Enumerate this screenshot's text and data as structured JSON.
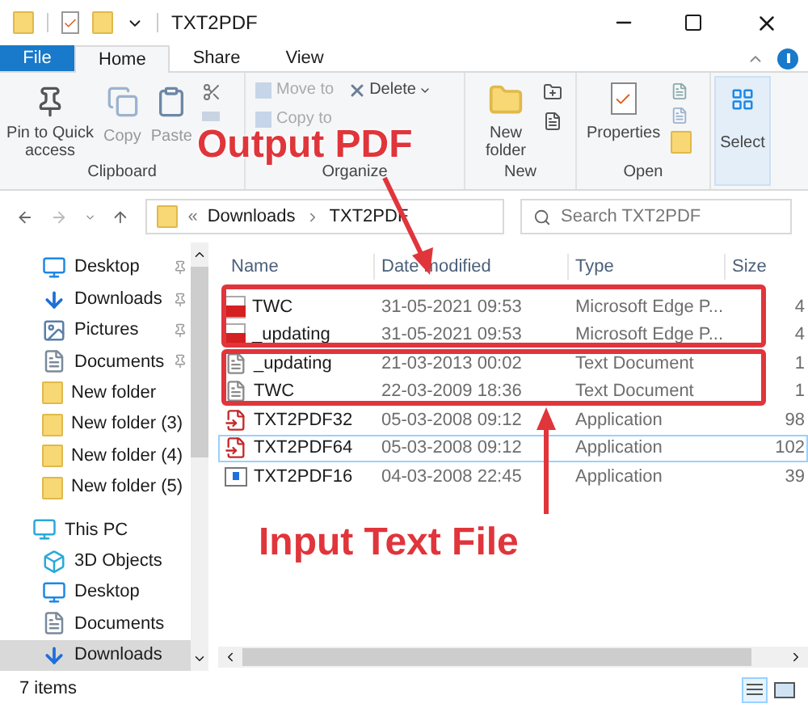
{
  "window": {
    "title": "TXT2PDF"
  },
  "tabs": [
    {
      "label": "File",
      "kind": "file",
      "selected": false
    },
    {
      "label": "Home",
      "kind": "tab",
      "selected": true
    },
    {
      "label": "Share",
      "kind": "tab",
      "selected": false
    },
    {
      "label": "View",
      "kind": "tab",
      "selected": false
    }
  ],
  "ribbon": {
    "clipboard": {
      "label": "Clipboard",
      "pin": "Pin to Quick access",
      "copy": "Copy",
      "paste": "Paste"
    },
    "organize": {
      "label": "Organize",
      "move_to": "Move to",
      "copy_to": "Copy to",
      "delete": "Delete"
    },
    "new": {
      "label": "New",
      "new_folder": "New folder"
    },
    "open": {
      "label": "Open",
      "properties": "Properties"
    },
    "select": {
      "label": "Select"
    }
  },
  "address": {
    "separator": "«",
    "path": [
      "Downloads",
      "TXT2PDF"
    ],
    "search": {
      "placeholder": "Search TXT2PDF"
    }
  },
  "sidebar": {
    "quick_access": [
      {
        "label": "Desktop",
        "kind": "desktop",
        "pinned": true,
        "selected": false
      },
      {
        "label": "Downloads",
        "kind": "downloads",
        "pinned": true,
        "selected": false
      },
      {
        "label": "Pictures",
        "kind": "pictures",
        "pinned": true,
        "selected": false
      },
      {
        "label": "Documents",
        "kind": "documents",
        "pinned": true,
        "selected": false
      },
      {
        "label": "New folder",
        "kind": "folder",
        "pinned": false,
        "selected": false
      },
      {
        "label": "New folder (3)",
        "kind": "folder",
        "pinned": false,
        "selected": false
      },
      {
        "label": "New folder (4)",
        "kind": "folder",
        "pinned": false,
        "selected": false
      },
      {
        "label": "New folder (5)",
        "kind": "folder",
        "pinned": false,
        "selected": false
      }
    ],
    "this_pc": {
      "label": "This PC",
      "children": [
        {
          "label": "3D Objects",
          "kind": "objects",
          "selected": false
        },
        {
          "label": "Desktop",
          "kind": "desktop",
          "selected": false
        },
        {
          "label": "Documents",
          "kind": "documents",
          "selected": false
        },
        {
          "label": "Downloads",
          "kind": "downloads",
          "selected": true
        }
      ]
    }
  },
  "table": {
    "columns": [
      "Name",
      "Date modified",
      "Type",
      "Size"
    ],
    "rows": [
      {
        "kind": "pdf",
        "name": "TWC",
        "date": "31-05-2021 09:53",
        "type": "Microsoft Edge P...",
        "size": "4",
        "selected": false
      },
      {
        "kind": "pdf",
        "name": "_updating",
        "date": "31-05-2021 09:53",
        "type": "Microsoft Edge P...",
        "size": "4",
        "selected": false
      },
      {
        "kind": "text",
        "name": "_updating",
        "date": "21-03-2013 00:02",
        "type": "Text Document",
        "size": "1",
        "selected": false
      },
      {
        "kind": "text",
        "name": "TWC",
        "date": "22-03-2009 18:36",
        "type": "Text Document",
        "size": "1",
        "selected": false
      },
      {
        "kind": "app",
        "name": "TXT2PDF32",
        "date": "05-03-2008 09:12",
        "type": "Application",
        "size": "98",
        "selected": false
      },
      {
        "kind": "app",
        "name": "TXT2PDF64",
        "date": "05-03-2008 09:12",
        "type": "Application",
        "size": "102",
        "selected": true
      },
      {
        "kind": "window",
        "name": "TXT2PDF16",
        "date": "04-03-2008 22:45",
        "type": "Application",
        "size": "39",
        "selected": false
      }
    ]
  },
  "status_bar": {
    "count": "7 items"
  },
  "annotations": [
    {
      "text": "Output PDF"
    },
    {
      "text": "Input Text File"
    }
  ]
}
